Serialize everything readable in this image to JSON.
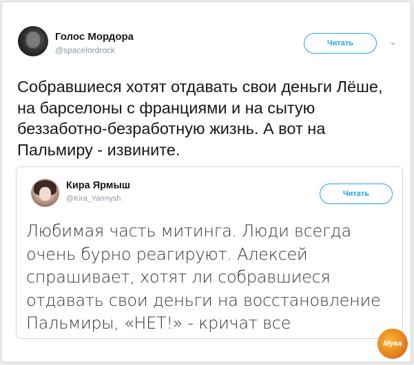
{
  "tweet": {
    "author_name": "Голос Мордора",
    "author_handle": "@spacelordrock",
    "follow_label": "Читать",
    "text": "Собравшиеся хотят отдавать свои деньги Лёше, на барселоны с франциями и на сытую беззаботно-безработную жизнь. А вот на Пальмиру - извините."
  },
  "quoted_tweet": {
    "author_name": "Кира Ярмыш",
    "author_handle": "@Kira_Yarmysh",
    "follow_label": "Читать",
    "text": "Любимая часть митинга. Люди всегда очень бурно реагируют. Алексей спрашивает, хотят ли собравшиеся отдавать свои деньги на восстановление Пальмиры, «НЕТ!» - кричат все"
  },
  "watermark": {
    "text": "Мука"
  },
  "icons": {
    "menu": "chevron-down-icon"
  },
  "colors": {
    "accent": "#1da1f2",
    "text": "#14171a",
    "muted": "#8899a6"
  }
}
